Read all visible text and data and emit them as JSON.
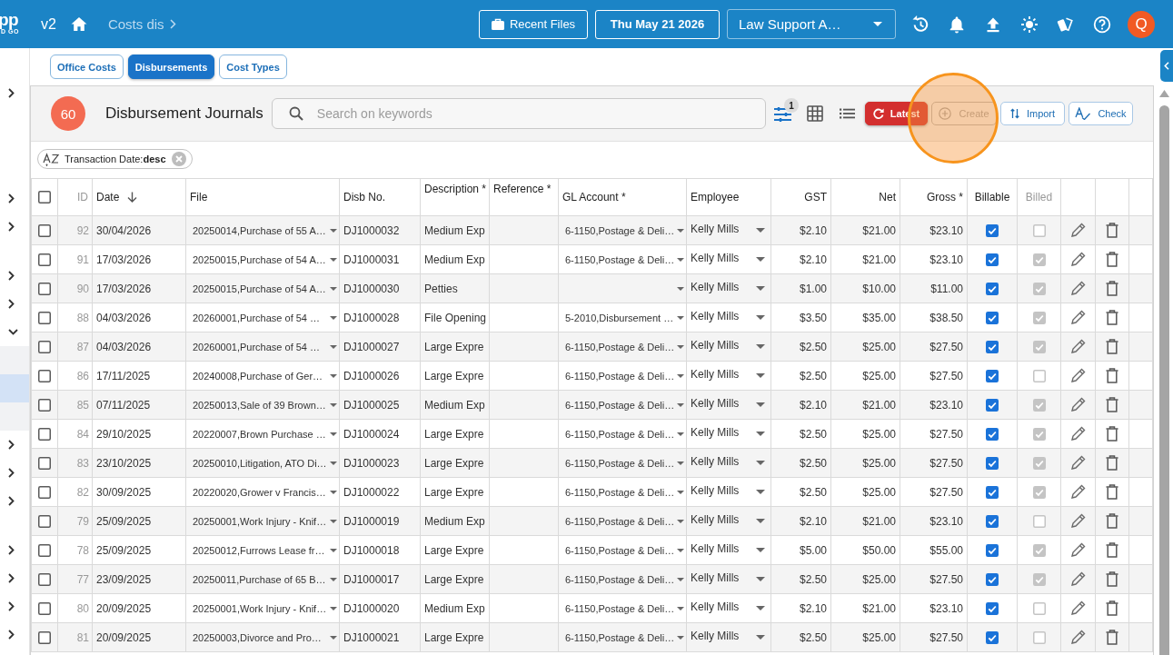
{
  "header": {
    "logo": "pp",
    "logo_tagline": "D GO",
    "version": "v2",
    "breadcrumb": "Costs dis",
    "recent_files": "Recent Files",
    "date": "Thu May 21 2026",
    "company": "Law Support A…",
    "avatar": "Q"
  },
  "sidebar": {
    "sections": [
      {
        "items": [
          {
            "expanded": false
          }
        ]
      },
      {
        "items": [
          {
            "expanded": false
          },
          {
            "expanded": false
          }
        ]
      },
      {
        "items": [
          {
            "expanded": false
          },
          {
            "expanded": false
          },
          {
            "expanded": true,
            "children": [
              {
                "selected": false
              },
              {
                "selected": true
              },
              {
                "selected": false
              }
            ]
          },
          {
            "expanded": false
          },
          {
            "expanded": false
          },
          {
            "expanded": false
          }
        ]
      },
      {
        "items": [
          {
            "expanded": false
          },
          {
            "expanded": false
          },
          {
            "expanded": false
          },
          {
            "expanded": false
          }
        ]
      }
    ]
  },
  "tabs": [
    {
      "label": "Office Costs",
      "selected": false
    },
    {
      "label": "Disbursements",
      "selected": true
    },
    {
      "label": "Cost Types",
      "selected": false
    }
  ],
  "journal": {
    "count": "60",
    "title": "Disbursement Journals",
    "search": {
      "placeholder": "Search on keywords"
    },
    "filter_badge": "1",
    "actions": [
      {
        "kind": "latest",
        "label": "Latest",
        "disabled": false,
        "highlighted": false
      },
      {
        "kind": "create",
        "label": "Create",
        "disabled": true,
        "highlighted": true
      },
      {
        "kind": "import",
        "label": "Import",
        "disabled": false,
        "highlighted": false
      },
      {
        "kind": "check",
        "label": "Check",
        "disabled": false,
        "highlighted": false
      }
    ],
    "sort_chip": "Transaction Date:**desc**"
  },
  "table": {
    "all_checked": false,
    "columns": [
      {
        "label": "ID",
        "sorted": false,
        "disabled": true
      },
      {
        "label": "Date",
        "sorted": true,
        "disabled": false
      },
      {
        "label": "File",
        "sorted": false,
        "disabled": false
      },
      {
        "label": "Disb No.",
        "sorted": false,
        "disabled": false
      },
      {
        "label": "Description *",
        "sorted": false,
        "disabled": false
      },
      {
        "label": "Reference *",
        "sorted": false,
        "disabled": false
      },
      {
        "label": "GL Account *",
        "sorted": false,
        "disabled": false
      },
      {
        "label": "Employee",
        "sorted": false,
        "disabled": false
      },
      {
        "label": "GST",
        "sorted": false,
        "disabled": false
      },
      {
        "label": "Net",
        "sorted": false,
        "disabled": false
      },
      {
        "label": "Gross *",
        "sorted": false,
        "disabled": false
      },
      {
        "label": "Billable",
        "sorted": false,
        "disabled": false
      },
      {
        "label": "Billed",
        "sorted": false,
        "disabled": true
      }
    ],
    "rows": [
      {
        "checked": false,
        "id": "92",
        "date": "30/04/2026",
        "file": "20250014,Purchase of 55 A…",
        "disb_no": "DJ1000032",
        "description": "Medium Exp",
        "gl_account": "6-1150,Postage & Deli…",
        "employee": "Kelly Mills",
        "gst": "$2.10",
        "net": "$21.00",
        "gross": "$23.10",
        "billable": true,
        "billed": false
      },
      {
        "checked": false,
        "id": "91",
        "date": "17/03/2026",
        "file": "20250015,Purchase of 54 A…",
        "disb_no": "DJ1000031",
        "description": "Medium Exp",
        "gl_account": "6-1150,Postage & Deli…",
        "employee": "Kelly Mills",
        "gst": "$2.10",
        "net": "$21.00",
        "gross": "$23.10",
        "billable": true,
        "billed": true
      },
      {
        "checked": false,
        "id": "90",
        "date": "17/03/2026",
        "file": "20250015,Purchase of 54 A…",
        "disb_no": "DJ1000030",
        "description": "Petties",
        "employee": "Kelly Mills",
        "gst": "$1.00",
        "net": "$10.00",
        "gross": "$11.00",
        "billable": true,
        "billed": true
      },
      {
        "checked": false,
        "id": "88",
        "date": "04/03/2026",
        "file": "20260001,Purchase of 54 …",
        "disb_no": "DJ1000028",
        "description": "File Opening",
        "gl_account": "5-2010,Disbursement …",
        "employee": "Kelly Mills",
        "gst": "$3.50",
        "net": "$35.00",
        "gross": "$38.50",
        "billable": true,
        "billed": true
      },
      {
        "checked": false,
        "id": "87",
        "date": "04/03/2026",
        "file": "20260001,Purchase of 54 …",
        "disb_no": "DJ1000027",
        "description": "Large Expre",
        "gl_account": "6-1150,Postage & Deli…",
        "employee": "Kelly Mills",
        "gst": "$2.50",
        "net": "$25.00",
        "gross": "$27.50",
        "billable": true,
        "billed": true
      },
      {
        "checked": false,
        "id": "86",
        "date": "17/11/2025",
        "file": "20240008,Purchase of Ger…",
        "disb_no": "DJ1000026",
        "description": "Large Expre",
        "gl_account": "6-1150,Postage & Deli…",
        "employee": "Kelly Mills",
        "gst": "$2.50",
        "net": "$25.00",
        "gross": "$27.50",
        "billable": true,
        "billed": false
      },
      {
        "checked": false,
        "id": "85",
        "date": "07/11/2025",
        "file": "20250013,Sale of 39 Brown…",
        "disb_no": "DJ1000025",
        "description": "Medium Exp",
        "gl_account": "6-1150,Postage & Deli…",
        "employee": "Kelly Mills",
        "gst": "$2.10",
        "net": "$21.00",
        "gross": "$23.10",
        "billable": true,
        "billed": true
      },
      {
        "checked": false,
        "id": "84",
        "date": "29/10/2025",
        "file": "20220007,Brown Purchase …",
        "disb_no": "DJ1000024",
        "description": "Large Expre",
        "gl_account": "6-1150,Postage & Deli…",
        "employee": "Kelly Mills",
        "gst": "$2.50",
        "net": "$25.00",
        "gross": "$27.50",
        "billable": true,
        "billed": true
      },
      {
        "checked": false,
        "id": "83",
        "date": "23/10/2025",
        "file": "20250010,Litigation, ATO Di…",
        "disb_no": "DJ1000023",
        "description": "Large Expre",
        "gl_account": "6-1150,Postage & Deli…",
        "employee": "Kelly Mills",
        "gst": "$2.50",
        "net": "$25.00",
        "gross": "$27.50",
        "billable": true,
        "billed": true
      },
      {
        "checked": false,
        "id": "82",
        "date": "30/09/2025",
        "file": "20220020,Grower v Francis…",
        "disb_no": "DJ1000022",
        "description": "Large Expre",
        "gl_account": "6-1150,Postage & Deli…",
        "employee": "Kelly Mills",
        "gst": "$2.50",
        "net": "$25.00",
        "gross": "$27.50",
        "billable": true,
        "billed": true
      },
      {
        "checked": false,
        "id": "79",
        "date": "25/09/2025",
        "file": "20250001,Work Injury - Knif…",
        "disb_no": "DJ1000019",
        "description": "Medium Exp",
        "gl_account": "6-1150,Postage & Deli…",
        "employee": "Kelly Mills",
        "gst": "$2.10",
        "net": "$21.00",
        "gross": "$23.10",
        "billable": true,
        "billed": false
      },
      {
        "checked": false,
        "id": "78",
        "date": "25/09/2025",
        "file": "20250012,Furrows Lease fr…",
        "disb_no": "DJ1000018",
        "description": "Large Expre",
        "gl_account": "6-1150,Postage & Deli…",
        "employee": "Kelly Mills",
        "gst": "$5.00",
        "net": "$50.00",
        "gross": "$55.00",
        "billable": true,
        "billed": true
      },
      {
        "checked": false,
        "id": "77",
        "date": "23/09/2025",
        "file": "20250011,Purchase of 65 B…",
        "disb_no": "DJ1000017",
        "description": "Large Expre",
        "gl_account": "6-1150,Postage & Deli…",
        "employee": "Kelly Mills",
        "gst": "$2.50",
        "net": "$25.00",
        "gross": "$27.50",
        "billable": true,
        "billed": true
      },
      {
        "checked": false,
        "id": "80",
        "date": "20/09/2025",
        "file": "20250001,Work Injury - Knif…",
        "disb_no": "DJ1000020",
        "description": "Medium Exp",
        "gl_account": "6-1150,Postage & Deli…",
        "employee": "Kelly Mills",
        "gst": "$2.10",
        "net": "$21.00",
        "gross": "$23.10",
        "billable": true,
        "billed": false
      },
      {
        "checked": false,
        "id": "81",
        "date": "20/09/2025",
        "file": "20250003,Divorce and Pro…",
        "disb_no": "DJ1000021",
        "description": "Large Expre",
        "gl_account": "6-1150,Postage & Deli…",
        "employee": "Kelly Mills",
        "gst": "$2.50",
        "net": "$25.00",
        "gross": "$27.50",
        "billable": true,
        "billed": false
      }
    ]
  }
}
